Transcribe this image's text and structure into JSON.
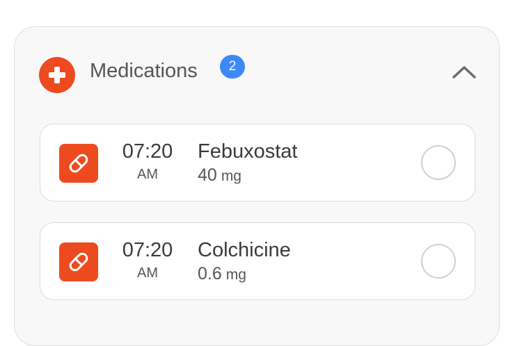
{
  "section": {
    "title": "Medications",
    "badge_count": "2",
    "accent_color": "#ee4a1f",
    "badge_color": "#3d8af7",
    "header_icon": "plus-icon",
    "collapse_icon": "chevron-up-icon"
  },
  "medications": [
    {
      "time": "07:20",
      "period": "AM",
      "name": "Febuxostat",
      "dose_value": "40",
      "dose_unit": "mg",
      "icon": "pill-icon",
      "taken": false
    },
    {
      "time": "07:20",
      "period": "AM",
      "name": "Colchicine",
      "dose_value": "0.6",
      "dose_unit": "mg",
      "icon": "pill-icon",
      "taken": false
    }
  ]
}
